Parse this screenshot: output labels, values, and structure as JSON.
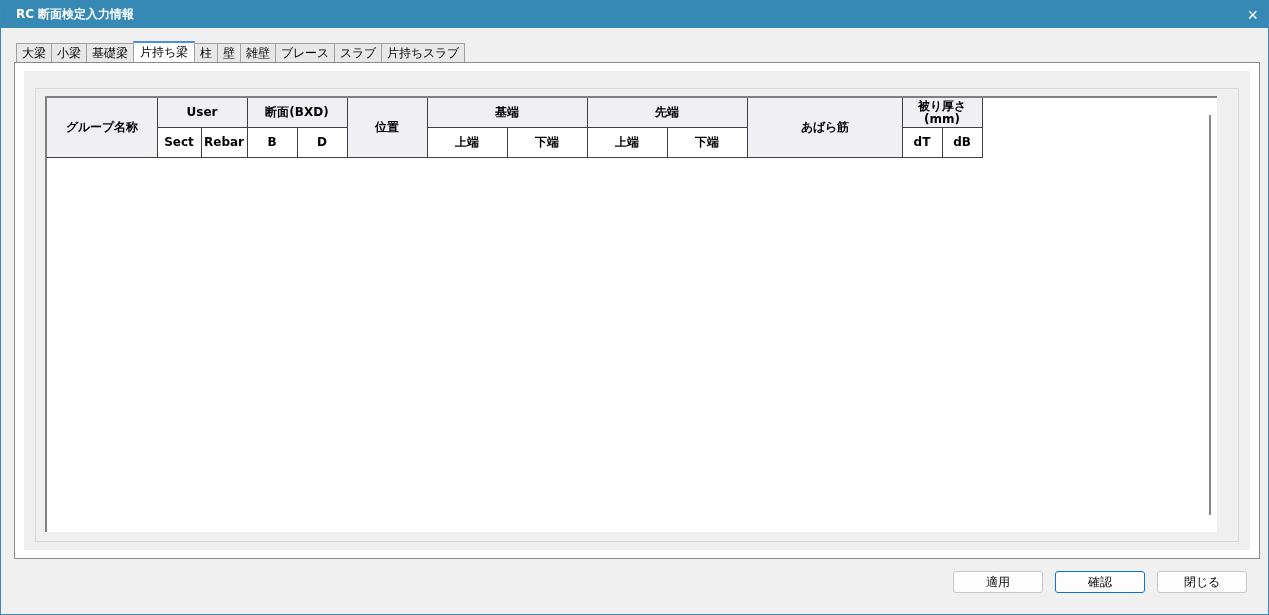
{
  "window": {
    "title": "RC 断面検定入力情報",
    "close": "×"
  },
  "tabs": [
    {
      "label": "大梁",
      "selected": false
    },
    {
      "label": "小梁",
      "selected": false
    },
    {
      "label": "基礎梁",
      "selected": false
    },
    {
      "label": "片持ち梁",
      "selected": true
    },
    {
      "label": "柱",
      "selected": false
    },
    {
      "label": "壁",
      "selected": false
    },
    {
      "label": "雑壁",
      "selected": false
    },
    {
      "label": "ブレース",
      "selected": false
    },
    {
      "label": "スラブ",
      "selected": false
    },
    {
      "label": "片持ちスラブ",
      "selected": false
    }
  ],
  "table": {
    "columns": [
      {
        "label": "グループ名称"
      },
      {
        "label": "User",
        "children": [
          {
            "label": "Sect"
          },
          {
            "label": "Rebar"
          }
        ]
      },
      {
        "label": "断面(BXD)",
        "children": [
          {
            "label": "B"
          },
          {
            "label": "D"
          }
        ]
      },
      {
        "label": "位置"
      },
      {
        "label": "基端",
        "children": [
          {
            "label": "上端"
          },
          {
            "label": "下端"
          }
        ]
      },
      {
        "label": "先端",
        "children": [
          {
            "label": "上端"
          },
          {
            "label": "下端"
          }
        ]
      },
      {
        "label": "あばら筋"
      },
      {
        "label": "被り厚さ\n(mm)",
        "children": [
          {
            "label": "dT"
          },
          {
            "label": "dB"
          }
        ]
      }
    ]
  },
  "buttons": [
    {
      "label": "適用",
      "focused": false
    },
    {
      "label": "確認",
      "focused": true
    },
    {
      "label": "閉じる",
      "focused": false
    }
  ]
}
